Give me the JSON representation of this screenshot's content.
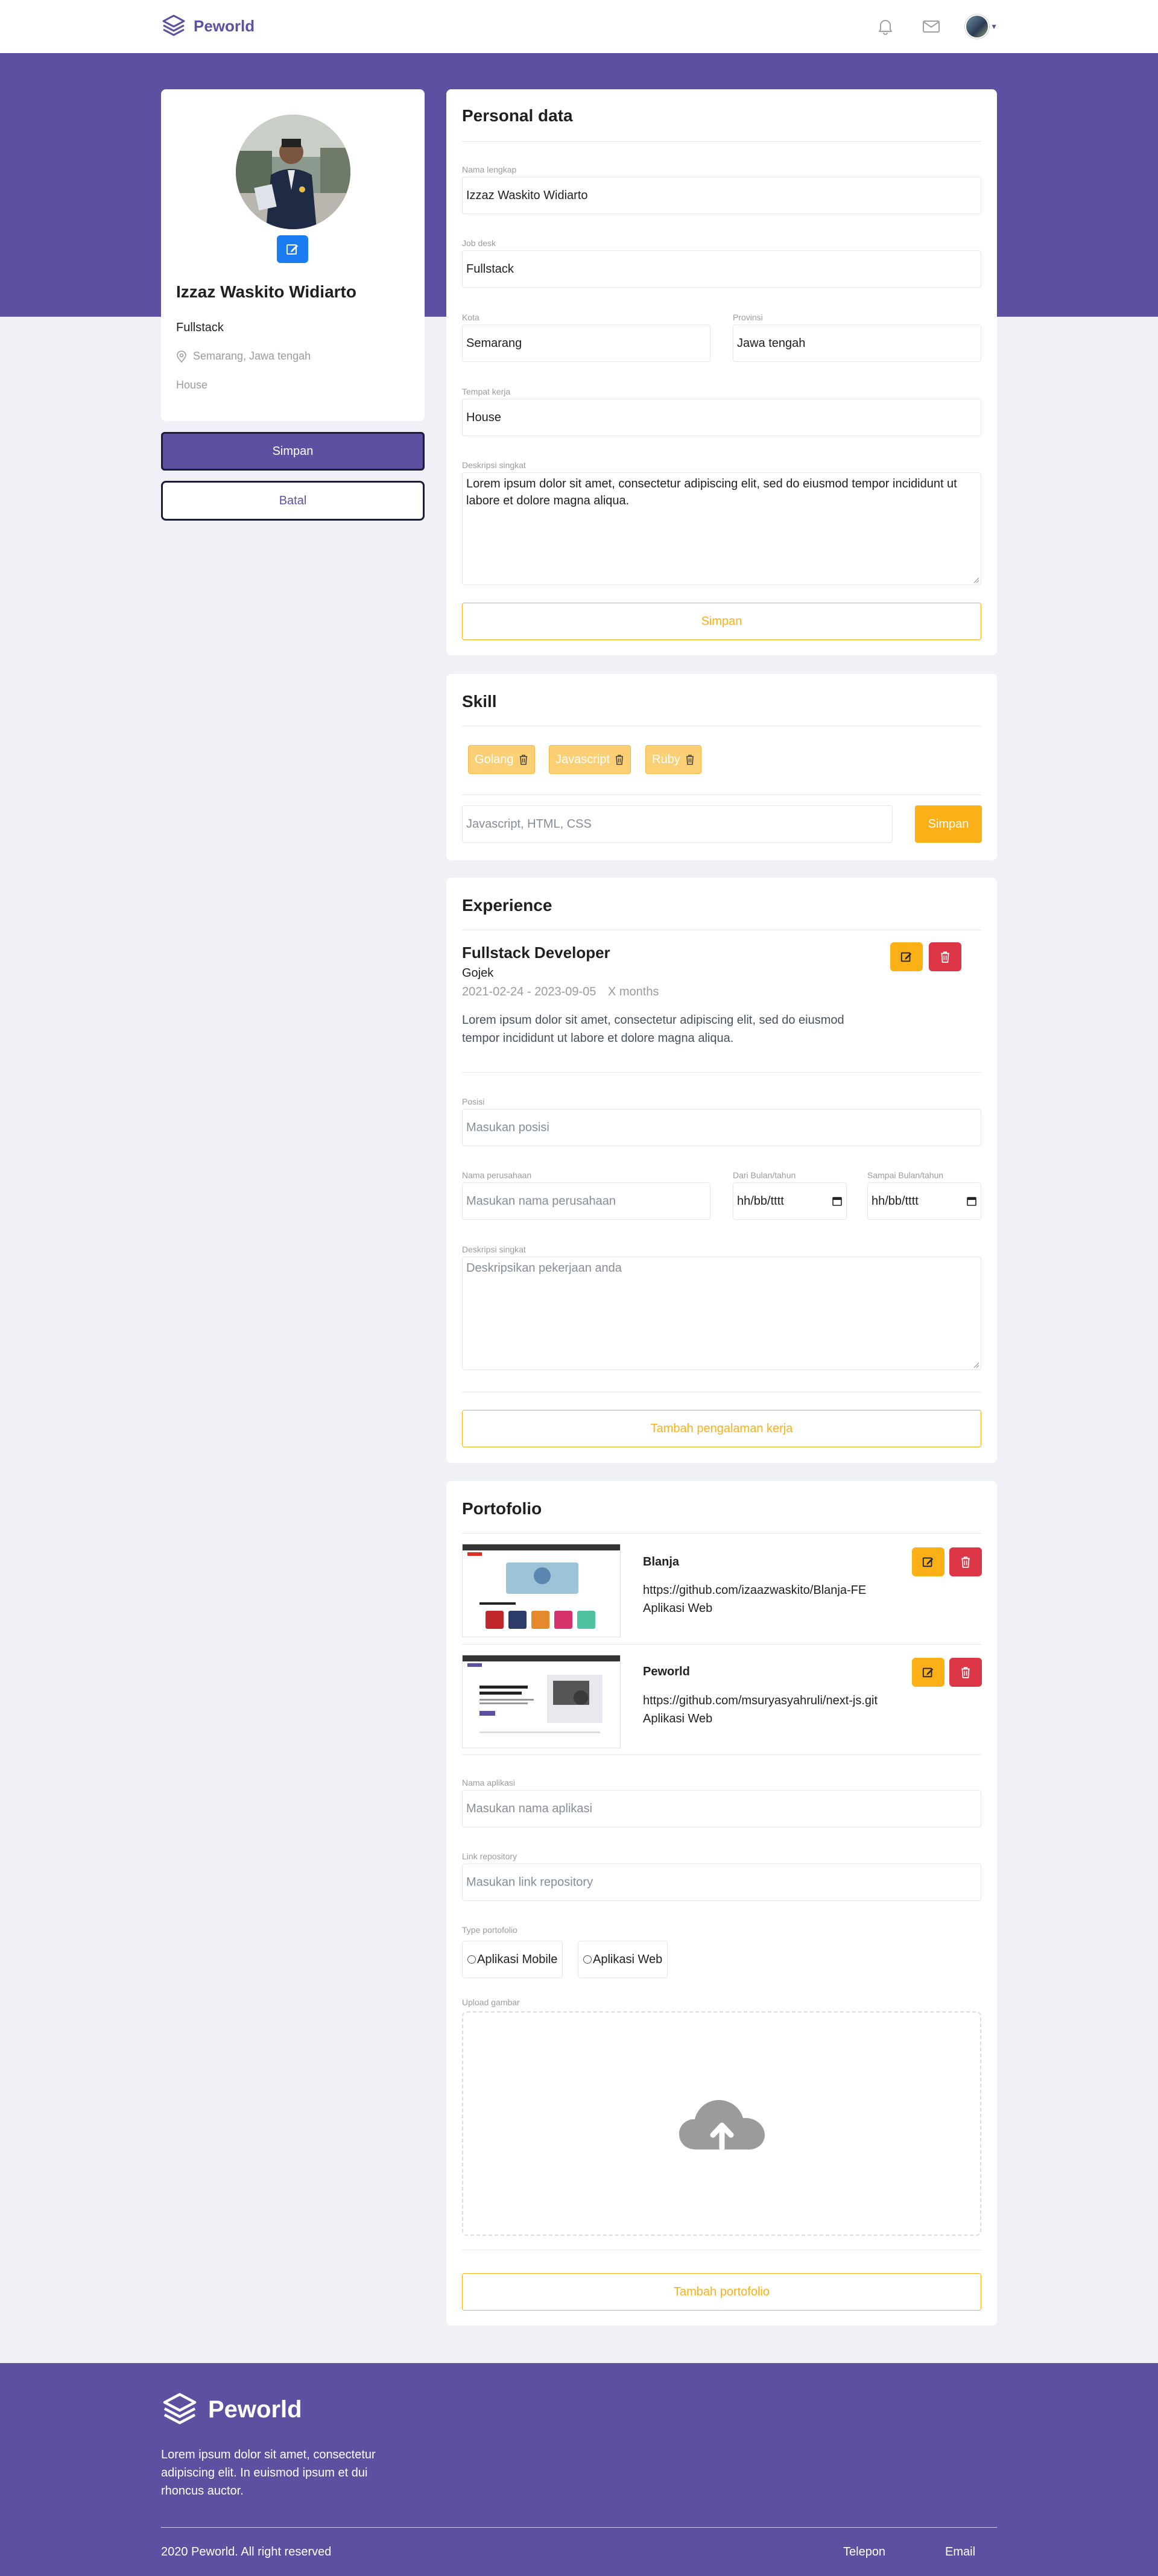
{
  "app": {
    "brand": "Peworld"
  },
  "navbar": {
    "icons": [
      "bell-icon",
      "mail-icon"
    ]
  },
  "profile": {
    "name": "Izzaz Waskito Widiarto",
    "job": "Fullstack",
    "location": "Semarang, Jawa tengah",
    "workplace": "House",
    "save_label": "Simpan",
    "cancel_label": "Batal"
  },
  "personal": {
    "title": "Personal data",
    "fullname_label": "Nama lengkap",
    "fullname_value": "Izzaz Waskito Widiarto",
    "job_label": "Job desk",
    "job_value": "Fullstack",
    "city_label": "Kota",
    "city_value": "Semarang",
    "province_label": "Provinsi",
    "province_value": "Jawa tengah",
    "workplace_label": "Tempat kerja",
    "workplace_value": "House",
    "desc_label": "Deskripsi singkat",
    "desc_value": "Lorem ipsum dolor sit amet, consectetur adipiscing elit, sed do eiusmod tempor incididunt ut labore et dolore magna aliqua.",
    "save_label": "Simpan"
  },
  "skill": {
    "title": "Skill",
    "items": [
      "Golang",
      "Javascript",
      "Ruby"
    ],
    "input_placeholder": "Javascript, HTML, CSS",
    "save_label": "Simpan"
  },
  "experience": {
    "title": "Experience",
    "entry": {
      "position": "Fullstack Developer",
      "company": "Gojek",
      "dates": "2021-02-24 - 2023-09-05",
      "duration": "X months",
      "description": "Lorem ipsum dolor sit amet, consectetur adipiscing elit, sed do eiusmod tempor incididunt ut labore et dolore magna aliqua."
    },
    "position_label": "Posisi",
    "position_placeholder": "Masukan posisi",
    "company_label": "Nama perusahaan",
    "company_placeholder": "Masukan nama perusahaan",
    "from_label": "Dari Bulan/tahun",
    "to_label": "Sampai Bulan/tahun",
    "date_placeholder": "hh/bb/tttt",
    "desc_label": "Deskripsi singkat",
    "desc_placeholder": "Deskripsikan pekerjaan anda",
    "add_label": "Tambah pengalaman kerja"
  },
  "portfolio": {
    "title": "Portofolio",
    "items": [
      {
        "name": "Blanja",
        "link": "https://github.com/izaazwaskito/Blanja-FE",
        "type": "Aplikasi Web"
      },
      {
        "name": "Peworld",
        "link": "https://github.com/msuryasyahruli/next-js.git",
        "type": "Aplikasi Web"
      }
    ],
    "appname_label": "Nama aplikasi",
    "appname_placeholder": "Masukan nama aplikasi",
    "repo_label": "Link repository",
    "repo_placeholder": "Masukan link repository",
    "type_label": "Type portofolio",
    "type_options": [
      "Aplikasi Mobile",
      "Aplikasi Web"
    ],
    "upload_label": "Upload gambar",
    "add_label": "Tambah portofolio"
  },
  "footer": {
    "brand": "Peworld",
    "description": "Lorem ipsum dolor sit amet, consectetur adipiscing elit. In euismod ipsum et dui rhoncus auctor.",
    "copyright": "2020 Peworld. All right reserved",
    "phone_label": "Telepon",
    "email_label": "Email"
  },
  "colors": {
    "primary": "#5e50a1",
    "accent": "#fbb017",
    "danger": "#dc3545",
    "edit_photo": "#1a7cf0"
  }
}
